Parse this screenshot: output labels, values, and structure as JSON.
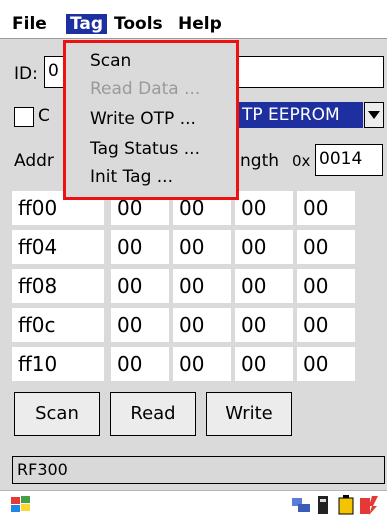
{
  "menubar": {
    "items": [
      "File",
      "Tag",
      "Tools",
      "Help"
    ],
    "active": "Tag"
  },
  "form": {
    "id_label": "ID:",
    "id_value": "0",
    "checkbox_label": "C",
    "memory_select_value": "TP EEPROM",
    "address_label": "Addr",
    "length_label": "ngth",
    "length_prefix": "0x",
    "length_value": "0014"
  },
  "memory_grid": {
    "rows": [
      {
        "address": "ff00",
        "cells": [
          "00",
          "00",
          "00",
          "00"
        ]
      },
      {
        "address": "ff04",
        "cells": [
          "00",
          "00",
          "00",
          "00"
        ]
      },
      {
        "address": "ff08",
        "cells": [
          "00",
          "00",
          "00",
          "00"
        ]
      },
      {
        "address": "ff0c",
        "cells": [
          "00",
          "00",
          "00",
          "00"
        ]
      },
      {
        "address": "ff10",
        "cells": [
          "00",
          "00",
          "00",
          "00"
        ]
      }
    ]
  },
  "buttons": {
    "scan": "Scan",
    "read": "Read",
    "write": "Write"
  },
  "status": {
    "reader": "RF300"
  },
  "tag_menu": {
    "items": [
      {
        "label": "Scan",
        "enabled": true
      },
      {
        "label": "Read Data ...",
        "enabled": false
      },
      {
        "label": "Write OTP ...",
        "enabled": true
      },
      {
        "label": "Tag Status ...",
        "enabled": true
      },
      {
        "label": "Init Tag ...",
        "enabled": true
      }
    ]
  },
  "colors": {
    "menu_highlight": "#1e2fa0",
    "dropdown_outline": "#ee1111",
    "select_highlight": "#1e2fa0"
  },
  "icons": [
    "windows-start-icon",
    "network-icon",
    "battery-icon",
    "card-icon",
    "power-icon"
  ]
}
